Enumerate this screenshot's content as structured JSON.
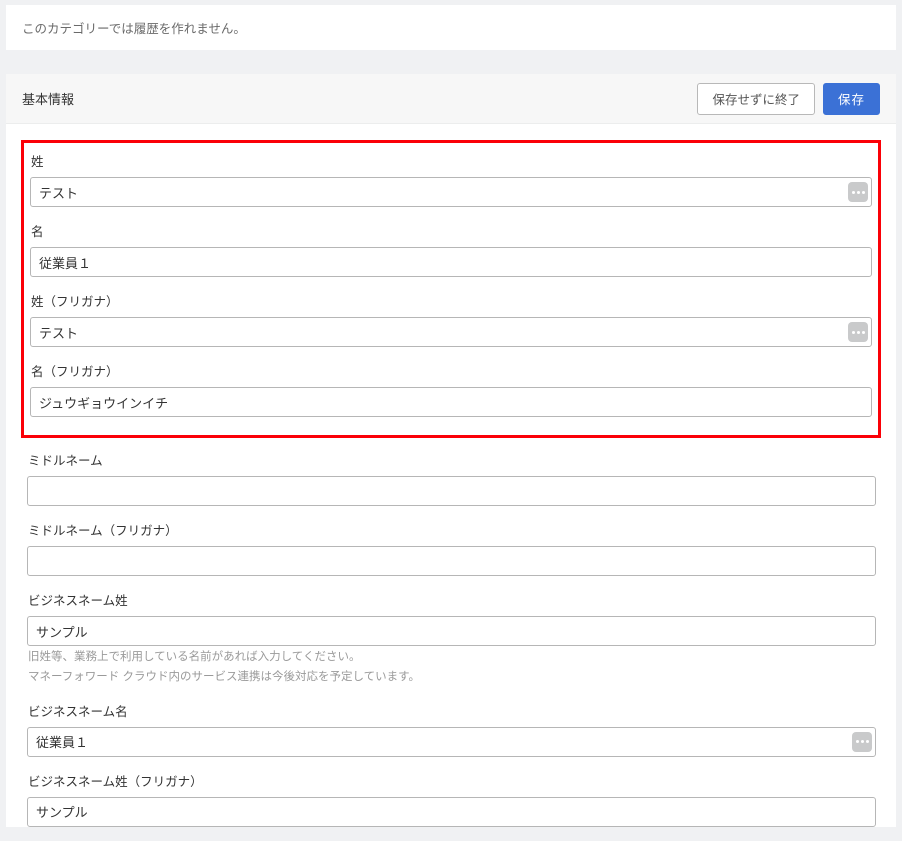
{
  "notice": "このカテゴリーでは履歴を作れません。",
  "panel": {
    "title": "基本情報",
    "btn_exit": "保存せずに終了",
    "btn_save": "保存"
  },
  "fields": {
    "last_name": {
      "label": "姓",
      "value": "テスト"
    },
    "first_name": {
      "label": "名",
      "value": "従業員１"
    },
    "last_name_kana": {
      "label": "姓（フリガナ）",
      "value": "テスト"
    },
    "first_name_kana": {
      "label": "名（フリガナ）",
      "value": "ジュウギョウインイチ"
    },
    "middle_name": {
      "label": "ミドルネーム",
      "value": ""
    },
    "middle_name_kana": {
      "label": "ミドルネーム（フリガナ）",
      "value": ""
    },
    "business_last_name": {
      "label": "ビジネスネーム姓",
      "value": "サンプル",
      "help1": "旧姓等、業務上で利用している名前があれば入力してください。",
      "help2": "マネーフォワード クラウド内のサービス連携は今後対応を予定しています。"
    },
    "business_first_name": {
      "label": "ビジネスネーム名",
      "value": "従業員１"
    },
    "business_last_name_kana": {
      "label": "ビジネスネーム姓（フリガナ）",
      "value": "サンプル"
    }
  }
}
